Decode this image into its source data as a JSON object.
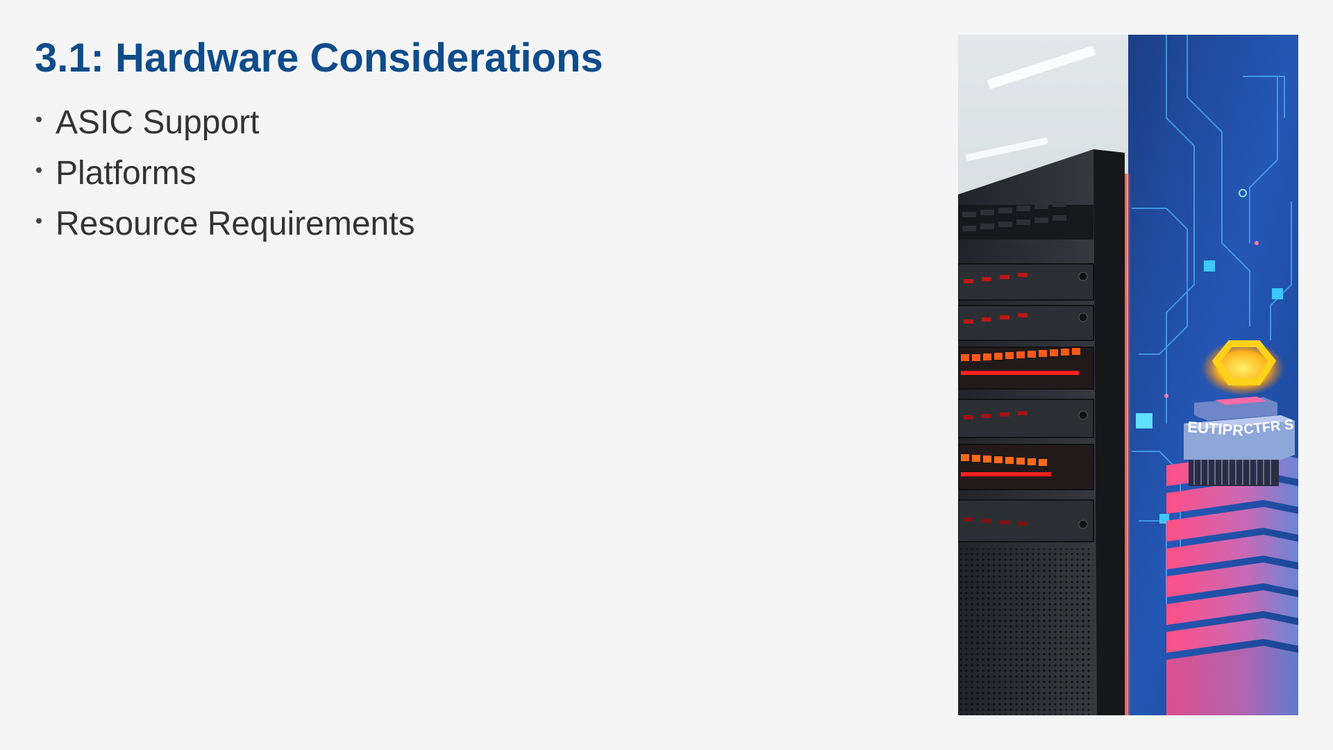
{
  "slide": {
    "title": "3.1: Hardware Considerations",
    "bullets": [
      "ASIC Support",
      "Platforms",
      "Resource Requirements"
    ]
  },
  "image": {
    "chip_label_left": "EUTIPR",
    "chip_label_right": "CTFR S"
  },
  "colors": {
    "title": "#0f4c8a",
    "body_text": "#333333",
    "background": "#f5f5f5",
    "panel_blue": "#1e4f9e",
    "glow_red": "#ff2a2a",
    "glow_pink": "#ff5a8a",
    "circuit_cyan": "#3ec8ff",
    "chip_yellow": "#ffcc1a"
  }
}
